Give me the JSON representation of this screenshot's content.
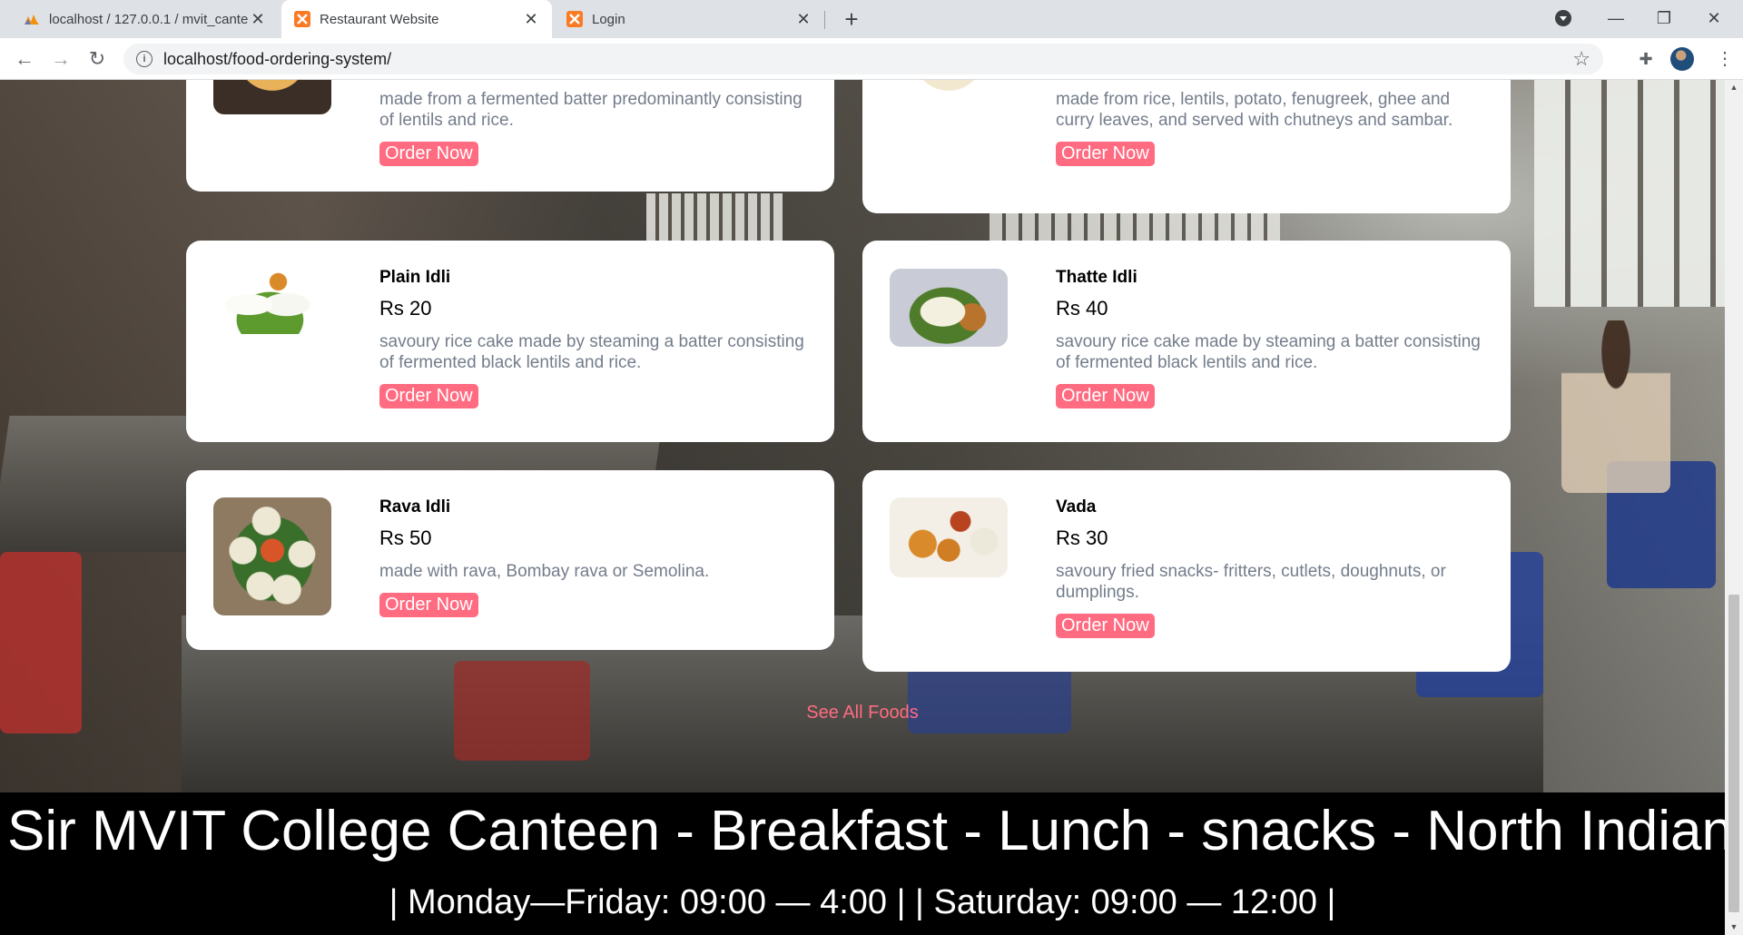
{
  "browser": {
    "tabs": [
      {
        "title": "localhost / 127.0.0.1 / mvit_cante",
        "icon": "phpmyadmin-icon",
        "active": false
      },
      {
        "title": "Restaurant Website",
        "icon": "xampp-icon",
        "active": true
      },
      {
        "title": "Login",
        "icon": "xampp-icon",
        "active": false
      }
    ],
    "url": "localhost/food-ordering-system/"
  },
  "foods": [
    {
      "name": "",
      "price": "",
      "description": "made from a fermented batter predominantly consisting of lentils and rice.",
      "button": "Order Now",
      "image": "dosa-image"
    },
    {
      "name": "",
      "price": "",
      "description": "made from rice, lentils, potato, fenugreek, ghee and curry leaves, and served with chutneys and sambar.",
      "button": "Order Now",
      "image": "masala-dosa-image"
    },
    {
      "name": "Plain Idli",
      "price": "Rs 20",
      "description": "savoury rice cake made by steaming a batter consisting of fermented black lentils and rice.",
      "button": "Order Now",
      "image": "plain-idli-image"
    },
    {
      "name": "Thatte Idli",
      "price": "Rs 40",
      "description": "savoury rice cake made by steaming a batter consisting of fermented black lentils and rice.",
      "button": "Order Now",
      "image": "thatte-idli-image"
    },
    {
      "name": "Rava Idli",
      "price": "Rs 50",
      "description": "made with rava, Bombay rava or Semolina.",
      "button": "Order Now",
      "image": "rava-idli-image"
    },
    {
      "name": "Vada",
      "price": "Rs 30",
      "description": "savoury fried snacks- fritters, cutlets, doughnuts, or dumplings.",
      "button": "Order Now",
      "image": "vada-image"
    }
  ],
  "see_all": "See All Foods",
  "footer": {
    "marquee": "Sir MVIT College Canteen - Breakfast - Lunch - snacks - North Indian",
    "hours": "| Monday—Friday: 09:00 — 4:00 | | Saturday: 09:00 — 12:00 |"
  },
  "colors": {
    "accent": "#ff6b81",
    "desc_text": "#747d8c",
    "footer_bg": "#000000"
  }
}
